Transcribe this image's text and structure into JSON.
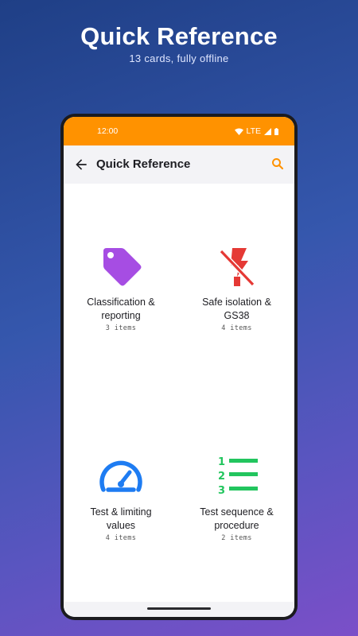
{
  "promo": {
    "title": "Quick Reference",
    "subtitle": "13 cards, fully offline"
  },
  "status_bar": {
    "time": "12:00",
    "network": "LTE"
  },
  "app_bar": {
    "title": "Quick Reference",
    "back_icon": "arrow-back-icon",
    "search_icon": "search-icon"
  },
  "cards": [
    {
      "label": "Classification & reporting",
      "count": "3 items",
      "icon": "tag-icon",
      "color": "#a64de3"
    },
    {
      "label": "Safe isolation & GS38",
      "count": "4 items",
      "icon": "power-off-icon",
      "color": "#e53935"
    },
    {
      "label": "Test & limiting values",
      "count": "4 items",
      "icon": "gauge-icon",
      "color": "#1e7cf2"
    },
    {
      "label": "Test sequence & procedure",
      "count": "2 items",
      "icon": "numbered-list-icon",
      "color": "#22c55e"
    }
  ],
  "colors": {
    "accent": "#ff9200"
  }
}
